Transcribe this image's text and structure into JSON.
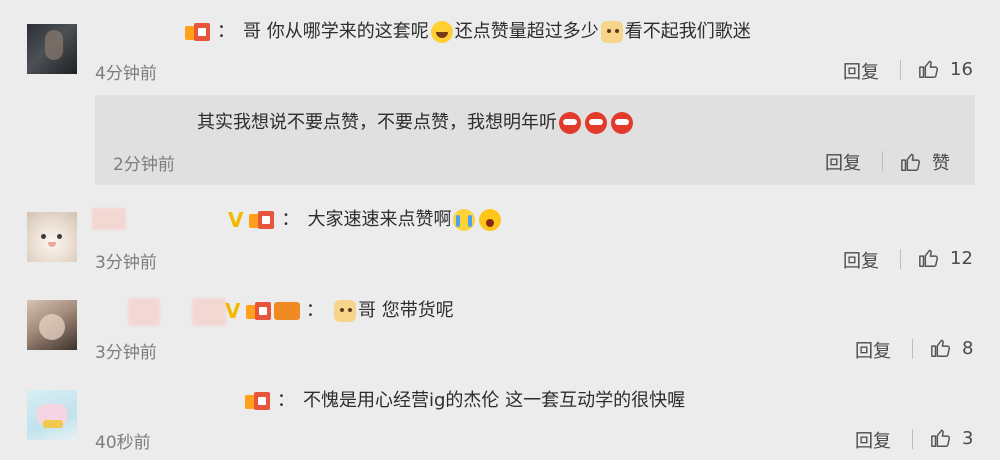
{
  "comments": [
    {
      "text_a": "哥 你从哪学来的这套呢",
      "text_b": "还点赞量超过多少",
      "text_c": "看不起我们歌迷",
      "time": "4分钟前",
      "reply_label": "回复",
      "likes": "16",
      "reply": {
        "text": "其实我想说不要点赞，不要点赞，我想明年听",
        "time": "2分钟前",
        "reply_label": "回复",
        "like_label": "赞"
      }
    },
    {
      "text": "大家速速来点赞啊",
      "time": "3分钟前",
      "reply_label": "回复",
      "likes": "12"
    },
    {
      "text": "哥 您带货呢",
      "time": "3分钟前",
      "reply_label": "回复",
      "likes": "8"
    },
    {
      "text": "不愧是用心经营ig的杰伦 这一套互动学的很快喔",
      "time": "40秒前",
      "reply_label": "回复",
      "likes": "3"
    }
  ],
  "badges": {
    "colon": "：",
    "v_label": "V"
  },
  "icons": {
    "thumb": "thumbs-up-icon"
  },
  "colors": {
    "background": "#ececec",
    "reply_box": "#e0e0e0",
    "badge_orange": "#ff9f1a",
    "badge_red": "#e8553d",
    "v_gold": "#f5b800"
  }
}
